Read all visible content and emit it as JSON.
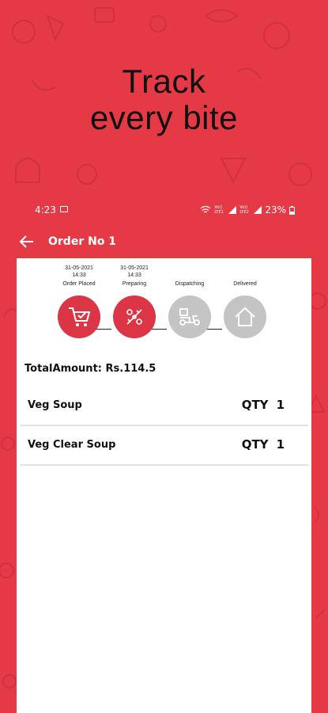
{
  "hero": {
    "line1": "Track",
    "line2": "every bite"
  },
  "status_bar": {
    "time": "4:23",
    "network_label_1": "Vo)) LTE1",
    "network_label_2": "Vo)) LTE2",
    "battery": "23%"
  },
  "appbar": {
    "title": "Order No 1"
  },
  "steps": [
    {
      "date": "31-05-2021",
      "time": "14:33",
      "label": "Order Placed",
      "state": "active",
      "icon": "shopping-cart-icon"
    },
    {
      "date": "31-05-2021",
      "time": "14:33",
      "label": "Preparing",
      "state": "active",
      "icon": "food-preparing-icon"
    },
    {
      "date": "",
      "time": "",
      "label": "Dispatching",
      "state": "inactive",
      "icon": "delivery-scooter-icon"
    },
    {
      "date": "",
      "time": "",
      "label": "Delivered",
      "state": "inactive",
      "icon": "home-icon"
    }
  ],
  "order": {
    "total_label": "TotalAmount: Rs.114.5",
    "items": [
      {
        "name": "Veg Soup",
        "qty_label": "QTY",
        "qty": "1"
      },
      {
        "name": "Veg Clear Soup",
        "qty_label": "QTY",
        "qty": "1"
      }
    ]
  },
  "colors": {
    "brand_red": "#e63946",
    "active_step": "#dc3545",
    "inactive_step": "#c4c4c4"
  }
}
